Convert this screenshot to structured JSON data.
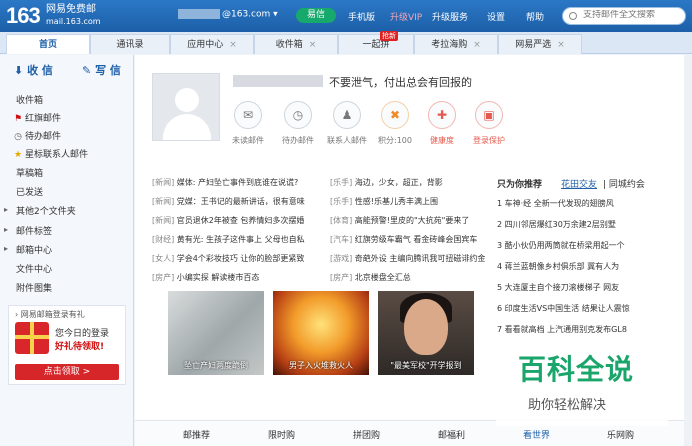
{
  "header": {
    "logo": "163",
    "logo_line1": "网易免费邮",
    "logo_line2": "mail.163.com",
    "account_suffix": "@163.com",
    "yixin": "易信",
    "nav": [
      "手机版",
      "升级VIP",
      "升级服务",
      "设置",
      "帮助"
    ],
    "search_placeholder": "支持邮件全文搜索"
  },
  "tabs": [
    {
      "label": "首页"
    },
    {
      "label": "通讯录"
    },
    {
      "label": "应用中心"
    },
    {
      "label": "收件箱"
    },
    {
      "label": "一起拼"
    },
    {
      "label": "考拉海购"
    },
    {
      "label": "网易严选"
    }
  ],
  "hot_badge": "抢新",
  "sidebar": {
    "receive": "收 信",
    "compose": "写 信",
    "items": [
      {
        "label": "收件箱",
        "icon": ""
      },
      {
        "label": "红旗邮件",
        "icon": "flag-icon"
      },
      {
        "label": "待办邮件",
        "icon": "clock-icon"
      },
      {
        "label": "星标联系人邮件",
        "icon": "star-icon"
      },
      {
        "label": "草稿箱",
        "icon": ""
      },
      {
        "label": "已发送",
        "icon": ""
      },
      {
        "label": "其他2个文件夹",
        "icon": "expand-icon"
      },
      {
        "label": "邮件标签",
        "icon": "expand-icon"
      },
      {
        "label": "邮箱中心",
        "icon": "expand-icon"
      },
      {
        "label": "文件中心",
        "icon": ""
      },
      {
        "label": "附件图集",
        "icon": ""
      }
    ],
    "promo": {
      "title": "网易邮箱登录有礼",
      "line1": "您今日的登录",
      "line2": "好礼待领取!",
      "button": "点击领取 >"
    }
  },
  "profile": {
    "slogan": "不要泄气，付出总会有回报的",
    "quick": [
      {
        "label": "未读邮件",
        "icon": "envelope-icon"
      },
      {
        "label": "待办邮件",
        "icon": "clock-icon"
      },
      {
        "label": "联系人邮件",
        "icon": "contact-star-icon"
      },
      {
        "label": "积分:100",
        "icon": "points-icon"
      },
      {
        "label": "健康度",
        "icon": "health-icon"
      },
      {
        "label": "登录保护",
        "icon": "lock-icon"
      }
    ]
  },
  "news": [
    {
      "l_cat": "[新闻]",
      "l_title": "媒体: 产妇坠亡事件到底谁在说谎?",
      "r_cat": "[乐手]",
      "r_title": "海边，少女，超正，背影"
    },
    {
      "l_cat": "[新闻]",
      "l_title": "党媒：王书记的最新讲话，很有意味",
      "r_cat": "[乐手]",
      "r_title": "性感!乐基儿秀丰满上围"
    },
    {
      "l_cat": "[新闻]",
      "l_title": "官员退休2年被查 包养情妇多次摆婚",
      "r_cat": "[体育]",
      "r_title": "高能预警!里皮的\"大抗苑\"要来了"
    },
    {
      "l_cat": "[财经]",
      "l_title": "黄有光: 生孩子这件事上 父母也自私",
      "r_cat": "[汽车]",
      "r_title": "红旗劳级车霸气 看金砖峰会国宾车"
    },
    {
      "l_cat": "[女人]",
      "l_title": "学会4个彩妆技巧 让你的脸部更紧致",
      "r_cat": "[游戏]",
      "r_title": "奇葩外设 主编向腾讯我可扭磁诽约金"
    },
    {
      "l_cat": "[房产]",
      "l_title": "小编实探 解读楼市百态",
      "r_cat": "[房产]",
      "r_title": "北京楼盘全汇总"
    }
  ],
  "photos": [
    {
      "caption": "坠亡产妇两度跪倒"
    },
    {
      "caption": "男子入火堆救火人"
    },
    {
      "caption": "\"最美军校\"开学报到"
    }
  ],
  "rank": {
    "heading": "只为你推荐",
    "tab2": "花田交友",
    "tab3": "同城约会",
    "items": [
      "1 车神·经 全新一代发现的翅膀风",
      "2 四川邻居爆红30万余建2层别墅",
      "3 酷小伙仍用两筒就在桥梁用起一个",
      "4 蒋兰蓝朝像乡村俱乐部 冀有人为",
      "5 大连厦主自个接刀滚楼梯子 网友",
      "6 印度生活VS中国生活 结果让人震惊",
      "7 看看就高档 上汽通用别克发布GL8"
    ]
  },
  "bottom": [
    "邮推荐",
    "限时购",
    "拼团购",
    "邮福利",
    "看世界",
    "乐网购"
  ],
  "watermark": {
    "line1": "百科全说",
    "line2": "助你轻松解决"
  }
}
